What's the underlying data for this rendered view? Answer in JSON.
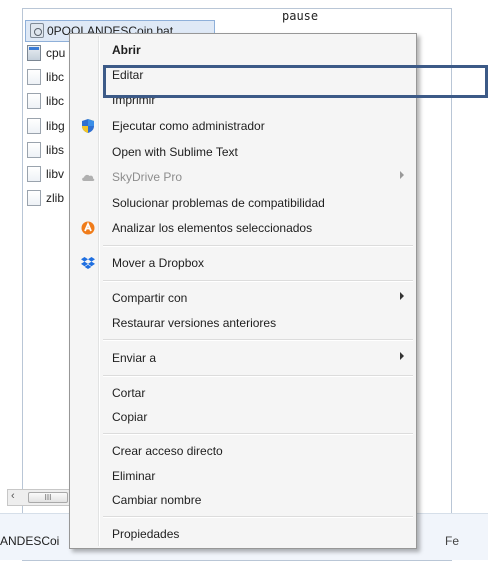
{
  "explorer": {
    "selected_file": "0POOLANDESCoin.bat",
    "files": [
      {
        "name": "cpu",
        "icon": "app-icon"
      },
      {
        "name": "libc",
        "icon": "document-icon"
      },
      {
        "name": "libc",
        "icon": "document-icon"
      },
      {
        "name": "libg",
        "icon": "document-icon"
      },
      {
        "name": "libs",
        "icon": "document-icon"
      },
      {
        "name": "libv",
        "icon": "document-icon"
      },
      {
        "name": "zlib",
        "icon": "document-icon"
      }
    ],
    "code_text": "pause",
    "scroll_left": "‹",
    "scroll_grip": "III",
    "status_name": "ANDESCoi",
    "status_right": "Fe"
  },
  "menu": {
    "items": [
      {
        "label": "Abrir",
        "bold": true
      },
      {
        "label": "Editar"
      },
      {
        "label": "Imprimir"
      },
      {
        "label": "Ejecutar como administrador",
        "icon": "uac-shield-icon"
      },
      {
        "label": "Open with Sublime Text"
      },
      {
        "label": "SkyDrive Pro",
        "icon": "skydrive-cloud-icon",
        "disabled": true,
        "submenu": true
      },
      {
        "label": "Solucionar problemas de compatibilidad"
      },
      {
        "label": "Analizar los elementos seleccionados",
        "icon": "avast-icon"
      },
      {
        "label": "Mover a Dropbox",
        "icon": "dropbox-icon"
      },
      {
        "label": "Compartir con",
        "submenu": true
      },
      {
        "label": "Restaurar versiones anteriores"
      },
      {
        "label": "Enviar a",
        "submenu": true
      },
      {
        "label": "Cortar"
      },
      {
        "label": "Copiar"
      },
      {
        "label": "Crear acceso directo"
      },
      {
        "label": "Eliminar"
      },
      {
        "label": "Cambiar nombre"
      },
      {
        "label": "Propiedades"
      }
    ]
  },
  "colors": {
    "highlight_box": "#3c5a87",
    "menu_background": "#f5f5f5",
    "selection": "#dfe9f6"
  }
}
